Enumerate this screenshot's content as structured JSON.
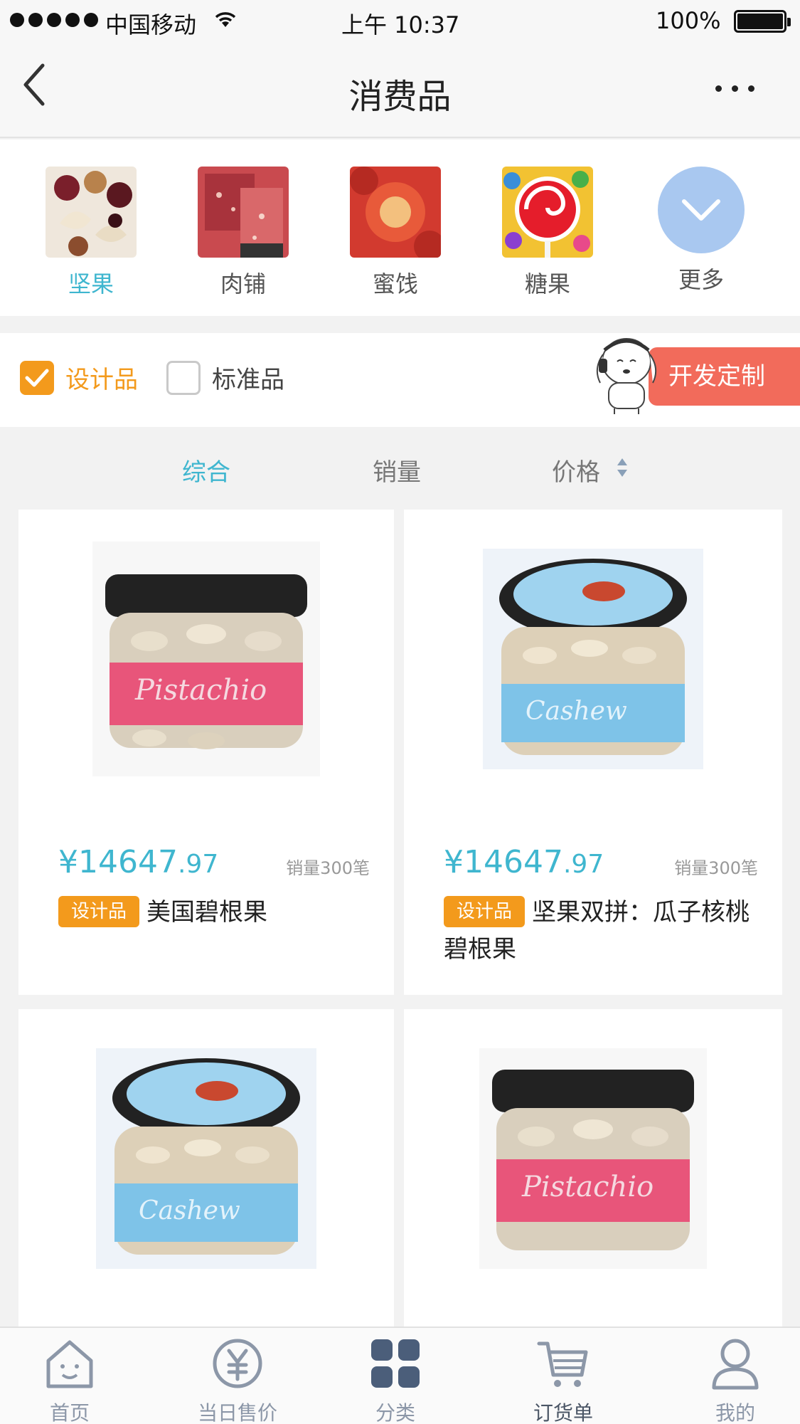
{
  "status_bar": {
    "carrier": "中国移动",
    "time": "上午 10:37",
    "battery": "100%"
  },
  "nav": {
    "title": "消费品"
  },
  "categories": [
    {
      "label": "坚果",
      "active": true
    },
    {
      "label": "肉铺",
      "active": false
    },
    {
      "label": "蜜饯",
      "active": false
    },
    {
      "label": "糖果",
      "active": false
    },
    {
      "label": "更多",
      "active": false
    }
  ],
  "filter": {
    "design_label": "设计品",
    "standard_label": "标准品",
    "custom_button": "开发定制"
  },
  "sort": {
    "overall": "综合",
    "sales": "销量",
    "price": "价格"
  },
  "products": [
    {
      "price_int": "¥14647",
      "price_dec": ".97",
      "sales": "销量300笔",
      "badge": "设计品",
      "name": "美国碧根果",
      "label_color": "#e8557a"
    },
    {
      "price_int": "¥14647",
      "price_dec": ".97",
      "sales": "销量300笔",
      "badge": "设计品",
      "name": "坚果双拼：瓜子核桃碧根果",
      "label_color": "#7ec3e8"
    },
    {
      "label_color": "#7ec3e8"
    },
    {
      "label_color": "#e8557a"
    }
  ],
  "tabbar": [
    {
      "label": "首页",
      "icon": "home-icon"
    },
    {
      "label": "当日售价",
      "icon": "yen-icon"
    },
    {
      "label": "分类",
      "icon": "grid-icon"
    },
    {
      "label": "订货单",
      "icon": "cart-icon",
      "active": true
    },
    {
      "label": "我的",
      "icon": "user-icon"
    }
  ],
  "colors": {
    "accent": "#3fb6cf",
    "orange": "#f39a1c",
    "red_button": "#f26b5b"
  }
}
